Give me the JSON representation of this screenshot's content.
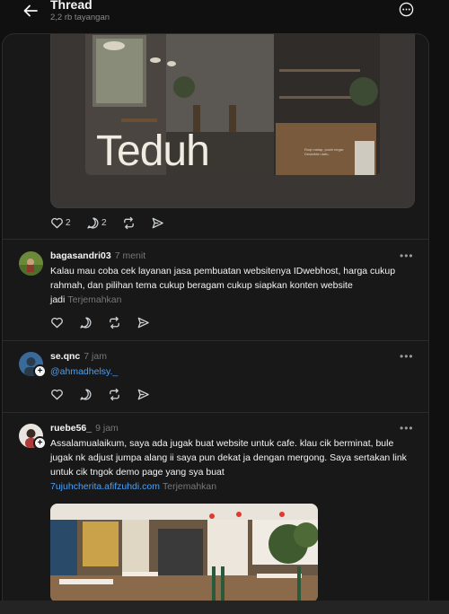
{
  "header": {
    "title": "Thread",
    "subtitle": "2,2 rb tayangan"
  },
  "hero_post": {
    "image_logo": "Teduh",
    "image_tagline": "Ruqi malap, pusiri negar. Deskriktin dafu.",
    "likes": "2",
    "replies": "2"
  },
  "replies": [
    {
      "username": "bagasandri03",
      "time": "7 menit",
      "text": "Kalau mau coba cek layanan jasa pembuatan websitenya IDwebhost, harga cukup rahmah, dan pilihan tema cukup beragam cukup siapkan konten website jadi",
      "translate": "Terjemahkan"
    },
    {
      "username": "se.qnc",
      "time": "7 jam",
      "mention": "@ahmadhelsy._"
    },
    {
      "username": "ruebe56_",
      "time": "9 jam",
      "text": "Assalamualaikum, saya ada jugak buat website untuk cafe. klau cik berminat, bule jugak nk adjust jumpa alang ii saya pun dekat ja dengan mergong. Saya sertakan link untuk cik tngok demo page yang sya buat",
      "link": "7ujuhcherita.afifzuhdi.com",
      "translate": "Terjemahkan"
    }
  ],
  "icons": [
    "back-arrow-icon",
    "more-circle-icon",
    "heart-icon",
    "comment-icon",
    "repost-icon",
    "share-icon",
    "more-dots-icon"
  ]
}
